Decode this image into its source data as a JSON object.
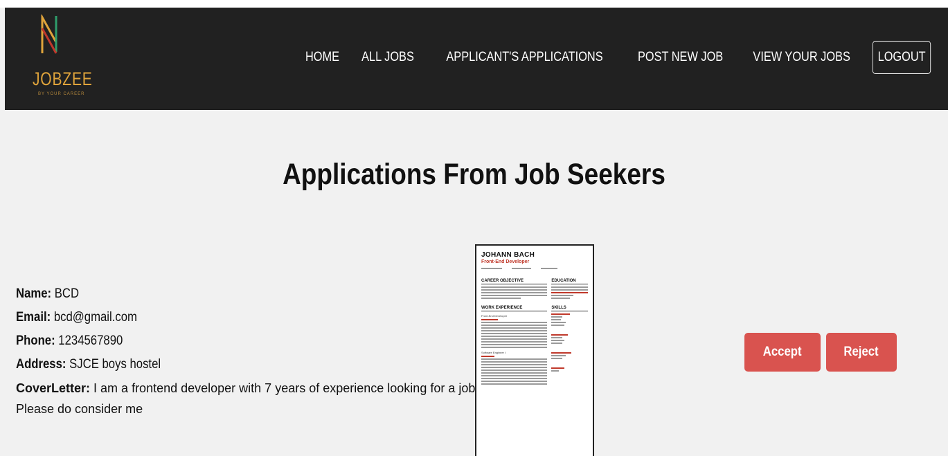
{
  "brand": {
    "name": "JOBZEE",
    "tagline": "BY YOUR CAREER",
    "colors": {
      "navbar": "#212121",
      "accent": "#e0a43b",
      "button": "#d9534f"
    }
  },
  "nav": {
    "items": [
      {
        "label": "HOME"
      },
      {
        "label": "ALL JOBS"
      },
      {
        "label": "APPLICANT'S APPLICATIONS"
      },
      {
        "label": "POST NEW JOB"
      },
      {
        "label": "VIEW YOUR JOBS"
      }
    ],
    "logout_label": "LOGOUT"
  },
  "page": {
    "title": "Applications From Job Seekers"
  },
  "application": {
    "name_label": "Name:",
    "name": "BCD",
    "email_label": "Email:",
    "email": "bcd@gmail.com",
    "phone_label": "Phone:",
    "phone": "1234567890",
    "address_label": "Address:",
    "address": "SJCE boys hostel",
    "cover_label": "CoverLetter:",
    "cover": "I am a frontend developer with 7 years of experience looking for a job. Please do consider me",
    "resume": {
      "name": "JOHANN BACH",
      "role": "Front-End Developer",
      "section_objective": "CAREER OBJECTIVE",
      "section_education": "EDUCATION",
      "section_experience": "WORK EXPERIENCE",
      "section_skills": "SKILLS",
      "job1": "Front-End Developer",
      "job2": "Software Engineer I"
    },
    "accept_label": "Accept",
    "reject_label": "Reject"
  }
}
